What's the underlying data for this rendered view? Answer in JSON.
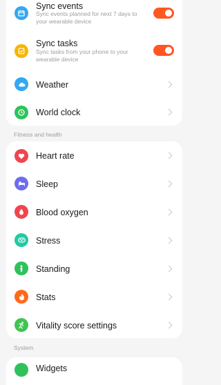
{
  "top_group": {
    "sync_events": {
      "title": "Sync events",
      "subtitle": "Sync events planned for next 7 days to your wearable device",
      "enabled": true
    },
    "sync_tasks": {
      "title": "Sync tasks",
      "subtitle": "Sync tasks from your phone to your wearable device",
      "enabled": true
    },
    "items": [
      {
        "label": "Weather",
        "icon": "weather-icon"
      },
      {
        "label": "World clock",
        "icon": "clock-icon"
      }
    ]
  },
  "fitness": {
    "header": "Fitness and health",
    "items": [
      {
        "label": "Heart rate",
        "icon": "heart-icon"
      },
      {
        "label": "Sleep",
        "icon": "bed-icon"
      },
      {
        "label": "Blood oxygen",
        "icon": "drop-icon"
      },
      {
        "label": "Stress",
        "icon": "stress-icon"
      },
      {
        "label": "Standing",
        "icon": "person-standing-icon"
      },
      {
        "label": "Stats",
        "icon": "flame-icon"
      },
      {
        "label": "Vitality score settings",
        "icon": "vitality-icon"
      }
    ]
  },
  "system": {
    "header": "System",
    "items": [
      {
        "label": "Widgets",
        "icon": "widgets-icon"
      }
    ]
  },
  "colors": {
    "accent": "#ff5722",
    "blue": "#34a8f0",
    "yellow": "#f7b500",
    "green": "#2fc25b",
    "red": "#f0454e",
    "purple": "#6d6cf0",
    "teal": "#24c9a4",
    "orange": "#ff6a1a",
    "limegreen": "#3fc452"
  }
}
